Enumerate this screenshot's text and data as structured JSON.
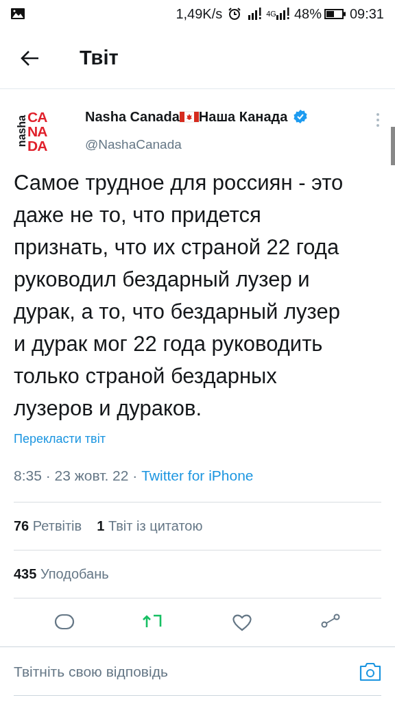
{
  "status_bar": {
    "speed": "1,49K/s",
    "network": "4G",
    "battery": "48%",
    "time": "09:31"
  },
  "header": {
    "title": "Твіт"
  },
  "tweet": {
    "avatar": {
      "side": "nasha",
      "lines": [
        "CA",
        "NA",
        "DA"
      ]
    },
    "name": [
      "Nasha Canada",
      "Наша Канада"
    ],
    "verified": true,
    "handle": "@NashaCanada",
    "text": "Самое трудное для россиян - это даже не то, что придется признать, что их страной 22 года руководил бездарный лузер и дурак, а то, что бездарный лузер и дурак мог 22 года руководить только страной бездарных лузеров и дураков.",
    "translate": "Перекласти твіт",
    "time": "8:35 · 23 жовт. 22 · ",
    "source": "Twitter for iPhone",
    "stats": [
      {
        "count": "76",
        "label": "Ретвітів"
      },
      {
        "count": "1",
        "label": "Твіт із цитатою"
      }
    ],
    "likes": {
      "count": "435",
      "label": "Уподобань"
    },
    "retweeted": true
  },
  "reply": {
    "placeholder": "Твітніть свою відповідь"
  }
}
